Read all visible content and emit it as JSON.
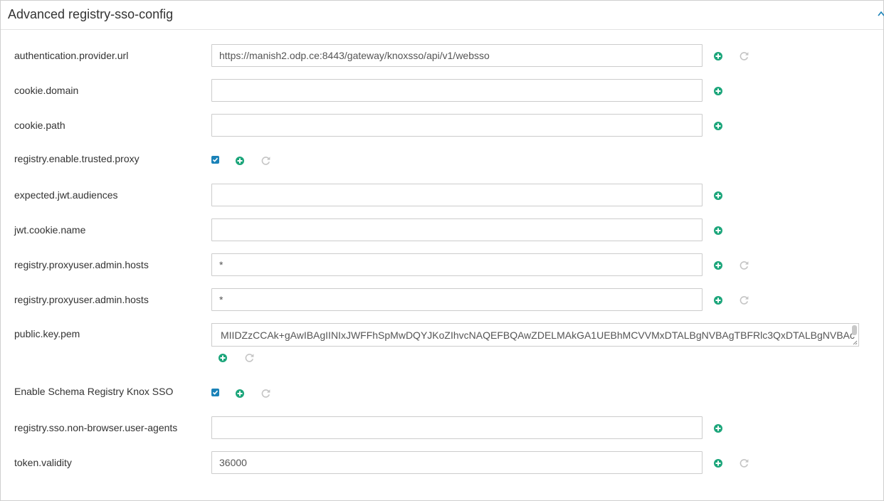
{
  "panel": {
    "title": "Advanced registry-sso-config"
  },
  "icons": {
    "collapse": "chevron-up-icon",
    "add": "plus-circle-icon",
    "undo": "undo-icon",
    "check": "checkmark-icon"
  },
  "colors": {
    "add_green": "#1ba57a",
    "undo_gray": "#c4c4c4",
    "checkbox_blue": "#1a82b8",
    "border": "#cccccc"
  },
  "fields": [
    {
      "label": "authentication.provider.url",
      "type": "text",
      "value": "https://manish2.odp.ce:8443/gateway/knoxsso/api/v1/websso",
      "has_undo": true
    },
    {
      "label": "cookie.domain",
      "type": "text",
      "value": "",
      "has_undo": false
    },
    {
      "label": "cookie.path",
      "type": "text",
      "value": "",
      "has_undo": false
    },
    {
      "label": "registry.enable.trusted.proxy",
      "type": "checkbox",
      "checked": true,
      "has_undo": true
    },
    {
      "label": "expected.jwt.audiences",
      "type": "text",
      "value": "",
      "has_undo": false
    },
    {
      "label": "jwt.cookie.name",
      "type": "text",
      "value": "",
      "has_undo": false
    },
    {
      "label": "registry.proxyuser.admin.hosts",
      "type": "text",
      "value": "*",
      "has_undo": true
    },
    {
      "label": "registry.proxyuser.admin.hosts",
      "type": "text",
      "value": "*",
      "has_undo": true
    },
    {
      "label": "public.key.pem",
      "type": "textarea",
      "value": "MIIDZzCCAk+gAwIBAgIINIxJWFFhSpMwDQYJKoZIhvcNAQEFBQAwZDELMAkGA1UEBhMCVVMxDTALBgNVBAgTBFRlc3QxDTALBgNVBAc",
      "has_undo": true
    },
    {
      "label": "Enable Schema Registry Knox SSO",
      "type": "checkbox",
      "checked": true,
      "has_undo": true
    },
    {
      "label": "registry.sso.non-browser.user-agents",
      "type": "text",
      "value": "",
      "has_undo": false
    },
    {
      "label": "token.validity",
      "type": "text",
      "value": "36000",
      "has_undo": true
    }
  ]
}
